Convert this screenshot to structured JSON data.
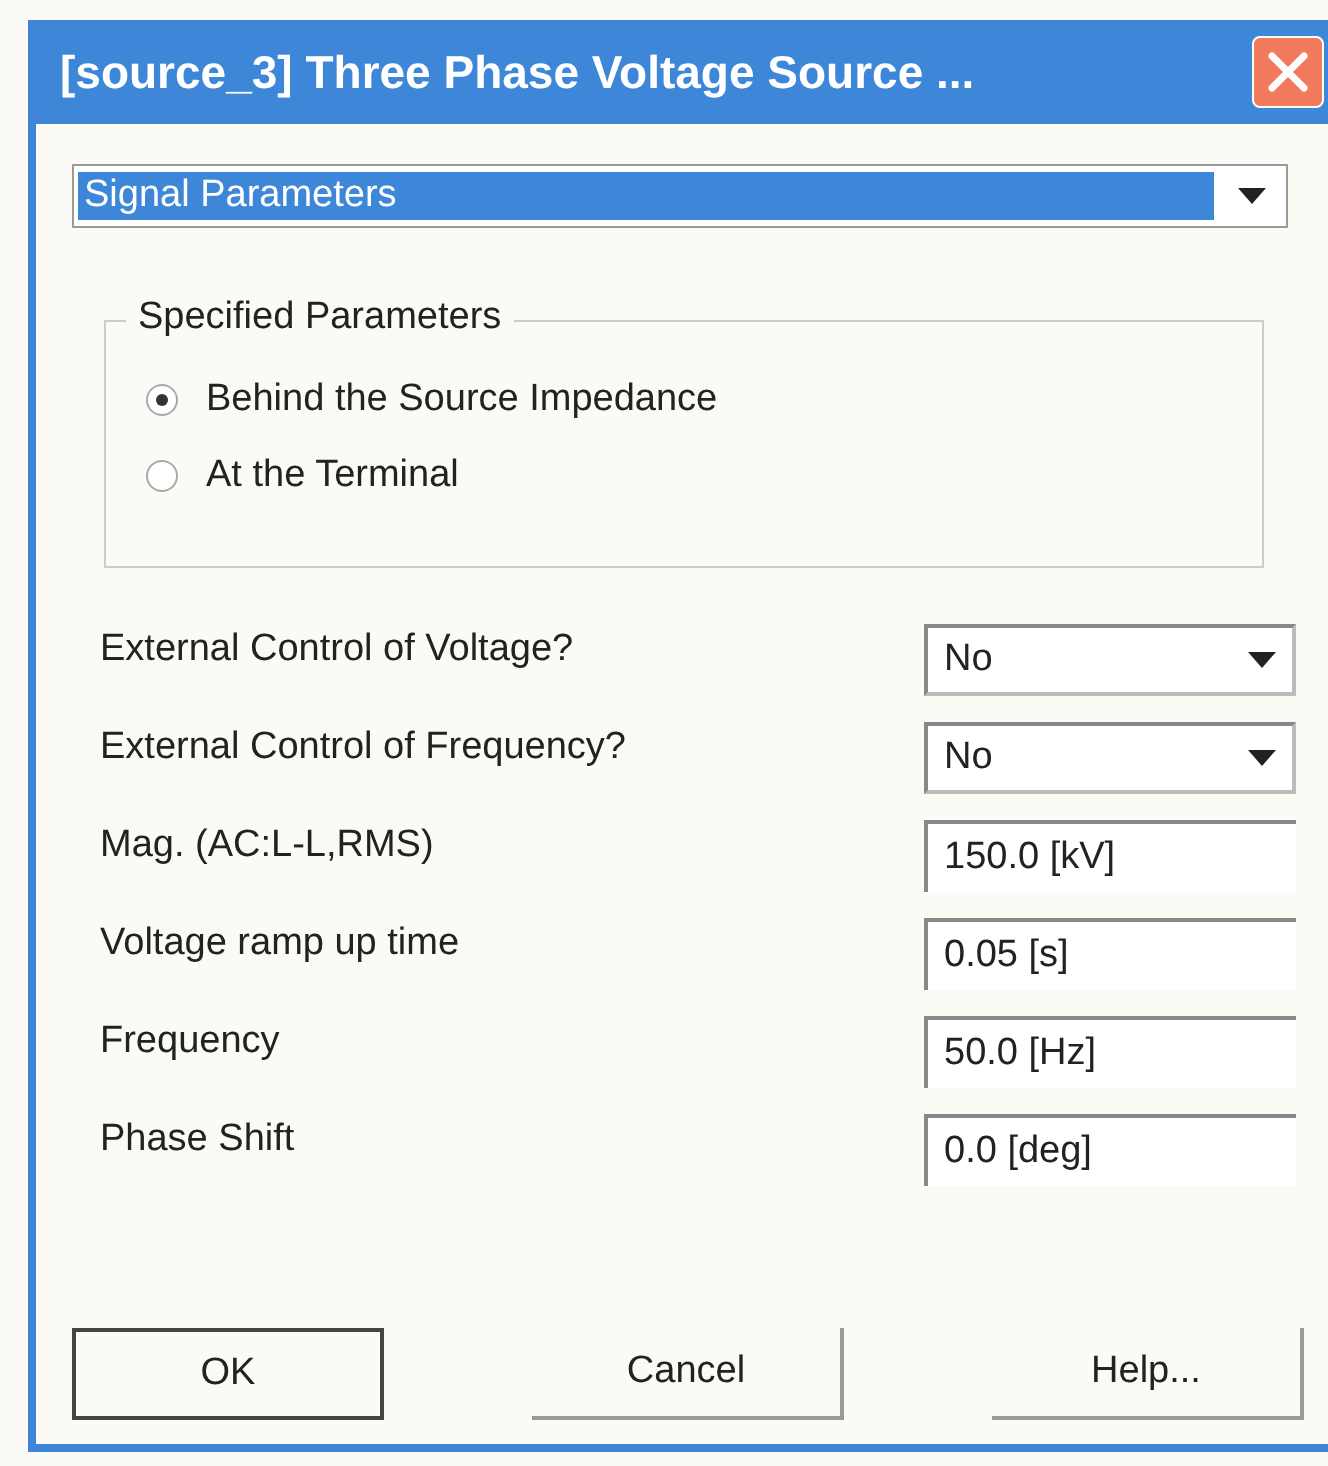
{
  "window": {
    "title": "[source_3] Three Phase Voltage Source ..."
  },
  "page_selector": {
    "value": "Signal Parameters"
  },
  "specified_parameters": {
    "title": "Specified Parameters",
    "options": [
      {
        "label": "Behind the Source Impedance",
        "selected": true
      },
      {
        "label": "At the Terminal",
        "selected": false
      }
    ]
  },
  "parameters": [
    {
      "kind": "dropdown",
      "label": "External Control of Voltage?",
      "value": "No"
    },
    {
      "kind": "dropdown",
      "label": "External Control of Frequency?",
      "value": "No"
    },
    {
      "kind": "text",
      "label": "Mag. (AC:L-L,RMS)",
      "value": "150.0 [kV]"
    },
    {
      "kind": "text",
      "label": "Voltage ramp up time",
      "value": "0.05 [s]"
    },
    {
      "kind": "text",
      "label": "Frequency",
      "value": "50.0 [Hz]"
    },
    {
      "kind": "text",
      "label": "Phase Shift",
      "value": "0.0 [deg]"
    }
  ],
  "buttons": [
    {
      "label": "OK",
      "default": true
    },
    {
      "label": "Cancel",
      "default": false
    },
    {
      "label": "Help...",
      "default": false
    }
  ]
}
